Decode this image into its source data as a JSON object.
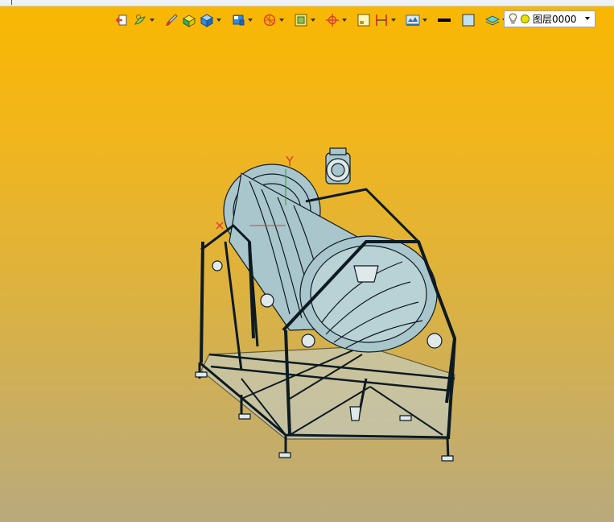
{
  "toolbar": {
    "items": [
      {
        "name": "exit-sketch-icon",
        "color": "#d9442c",
        "has_dropdown": false
      },
      {
        "name": "display-mode-icon",
        "color": "#3c9a2c",
        "has_dropdown": true
      },
      {
        "name": "brush-icon",
        "color": "#c43a2c",
        "has_dropdown": false
      },
      {
        "name": "shaded-box-icon",
        "color": "#e8c400",
        "has_dropdown": false
      },
      {
        "name": "iso-cube-icon",
        "color": "#2f8be0",
        "has_dropdown": true
      },
      {
        "name": "named-view-icon",
        "color": "#2f8be0",
        "has_dropdown": true
      },
      {
        "name": "section-view-icon",
        "color": "#d9442c",
        "has_dropdown": true
      },
      {
        "name": "zoom-fit-icon",
        "color": "#8f8f20",
        "has_dropdown": true
      },
      {
        "name": "axis-target-icon",
        "color": "#d9442c",
        "has_dropdown": true
      },
      {
        "name": "frame-select-icon",
        "color": "#c99a00",
        "has_dropdown": false
      },
      {
        "name": "dimension-icon",
        "color": "#d9442c",
        "has_dropdown": true
      },
      {
        "name": "render-settings-icon",
        "color": "#2f6fb0",
        "has_dropdown": true
      },
      {
        "name": "line-color-icon",
        "color": "#000000",
        "has_dropdown": false
      },
      {
        "name": "fill-color-icon",
        "color": "#bfe2f5",
        "has_dropdown": false
      },
      {
        "name": "layer-stack-icon",
        "color": "#2fa0a0",
        "has_dropdown": true
      }
    ]
  },
  "layer": {
    "label": "图层0000"
  },
  "model": {
    "tubeColor": "#a9c6cc",
    "lineColor": "#0d1a22"
  }
}
